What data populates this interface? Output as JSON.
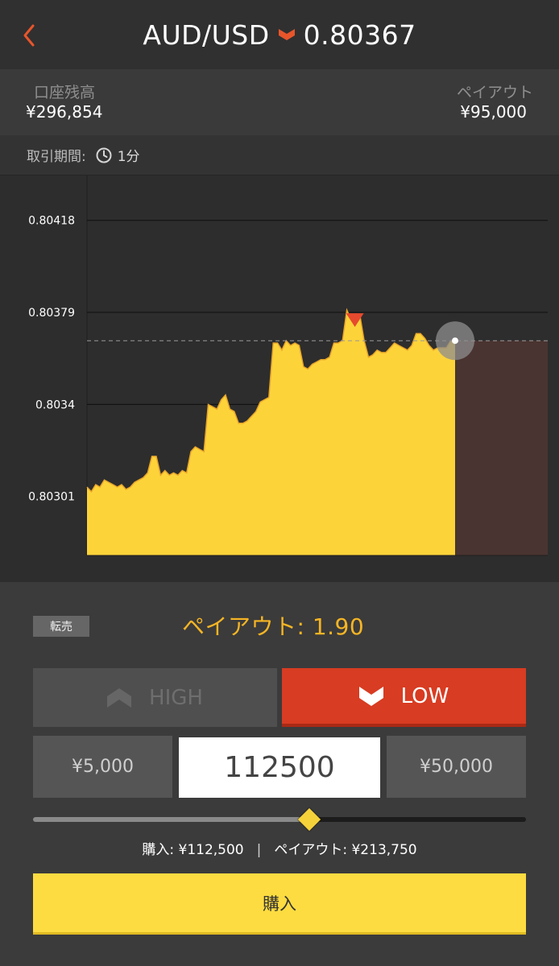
{
  "header": {
    "pair": "AUD/USD",
    "rate": "0.80367",
    "back_icon": "chevron-left-icon",
    "direction_icon": "chevron-down-icon",
    "accent_color": "#e8552b"
  },
  "account": {
    "balance_label": "口座残高",
    "balance_value": "¥296,854",
    "payout_label": "ペイアウト",
    "payout_value": "¥95,000"
  },
  "period": {
    "label": "取引期間:",
    "icon": "clock-icon",
    "value": "1分"
  },
  "chart_data": {
    "type": "area",
    "y_tick_labels": [
      "0.80418",
      "0.80379",
      "0.8034",
      "0.80301"
    ],
    "ylim": [
      0.80276,
      0.80437
    ],
    "current_rate": 0.80367,
    "fill_color": "#fdd33a",
    "line_color": "#e8a52a",
    "grid": true,
    "values": [
      0.80305,
      0.80303,
      0.80306,
      0.80305,
      0.80308,
      0.80307,
      0.80306,
      0.80305,
      0.80306,
      0.80304,
      0.80305,
      0.80307,
      0.80308,
      0.80309,
      0.80311,
      0.80318,
      0.80318,
      0.8031,
      0.80312,
      0.8031,
      0.80311,
      0.8031,
      0.80312,
      0.80311,
      0.8032,
      0.80322,
      0.80321,
      0.8032,
      0.8034,
      0.80339,
      0.80338,
      0.80342,
      0.80344,
      0.80338,
      0.80337,
      0.80332,
      0.80332,
      0.80333,
      0.80335,
      0.80337,
      0.80341,
      0.80342,
      0.80343,
      0.80366,
      0.80366,
      0.80363,
      0.80367,
      0.80365,
      0.80366,
      0.80365,
      0.80356,
      0.80355,
      0.80357,
      0.80358,
      0.80359,
      0.80359,
      0.8036,
      0.80366,
      0.80366,
      0.80367,
      0.8038,
      0.80376,
      0.80378,
      0.80378,
      0.80367,
      0.8036,
      0.80361,
      0.80363,
      0.80362,
      0.80362,
      0.80364,
      0.80366,
      0.80365,
      0.80364,
      0.80363,
      0.80365,
      0.8037,
      0.8037,
      0.80368,
      0.80365,
      0.80363,
      0.80364,
      0.80364,
      0.80364,
      0.80367,
      0.80367
    ]
  },
  "trade": {
    "resell_label": "転売",
    "payout_rate_text": "ペイアウト: 1.90",
    "high_label": "HIGH",
    "low_label": "LOW",
    "preset_low": "¥5,000",
    "amount_value": "112500",
    "preset_high": "¥50,000",
    "slider_fraction": 0.56,
    "summary_purchase": "購入: ¥112,500",
    "summary_separator": "|",
    "summary_payout": "ペイアウト: ¥213,750",
    "buy_label": "購入",
    "low_color": "#d83c22",
    "buy_color": "#fddc41"
  }
}
